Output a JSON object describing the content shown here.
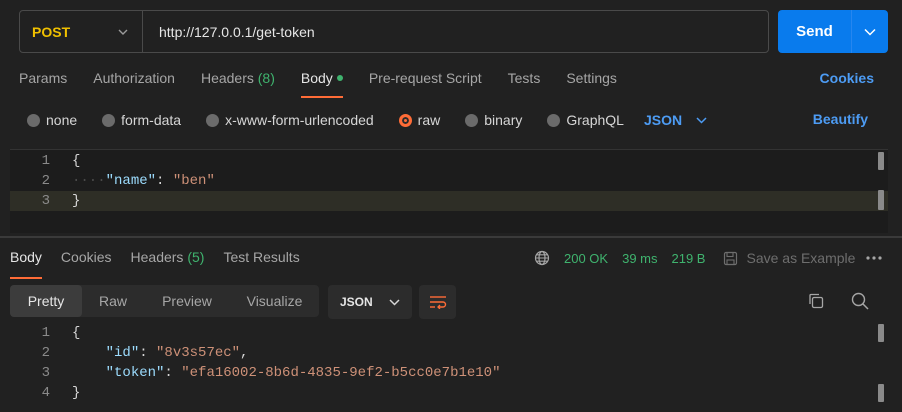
{
  "request": {
    "method": "POST",
    "url": "http://127.0.0.1/get-token",
    "send_label": "Send"
  },
  "request_tabs": [
    {
      "label": "Params"
    },
    {
      "label": "Authorization"
    },
    {
      "label": "Headers",
      "count": "(8)"
    },
    {
      "label": "Body",
      "active": true
    },
    {
      "label": "Pre-request Script"
    },
    {
      "label": "Tests"
    },
    {
      "label": "Settings"
    }
  ],
  "cookies_label": "Cookies",
  "body_types": {
    "options": [
      "none",
      "form-data",
      "x-www-form-urlencoded",
      "raw",
      "binary",
      "GraphQL"
    ],
    "selected": "raw",
    "format": "JSON",
    "beautify_label": "Beautify"
  },
  "request_body": {
    "lines": [
      {
        "n": "1",
        "text": "{"
      },
      {
        "n": "2",
        "key": "\"name\"",
        "value": "\"ben\""
      },
      {
        "n": "3",
        "text": "}"
      }
    ]
  },
  "response_tabs": [
    {
      "label": "Body",
      "active": true
    },
    {
      "label": "Cookies"
    },
    {
      "label": "Headers",
      "count": "(5)"
    },
    {
      "label": "Test Results"
    }
  ],
  "response_stats": {
    "status": "200 OK",
    "time": "39 ms",
    "size": "219 B",
    "save_label": "Save as Example"
  },
  "view_modes": [
    "Pretty",
    "Raw",
    "Preview",
    "Visualize"
  ],
  "view_mode_active": "Pretty",
  "response_format": "JSON",
  "response_body": {
    "lines": [
      {
        "n": "1",
        "text": "{"
      },
      {
        "n": "2",
        "key": "\"id\"",
        "value": "\"8v3s57ec\"",
        "comma": ","
      },
      {
        "n": "3",
        "key": "\"token\"",
        "value": "\"efa16002-8b6d-4835-9ef2-b5cc0e7b1e10\""
      },
      {
        "n": "4",
        "text": "}"
      }
    ]
  },
  "colors": {
    "accent": "#ff6c37",
    "primary": "#097bed",
    "link": "#4d9cf4",
    "success": "#3fb36e",
    "method": "#f0c000"
  }
}
